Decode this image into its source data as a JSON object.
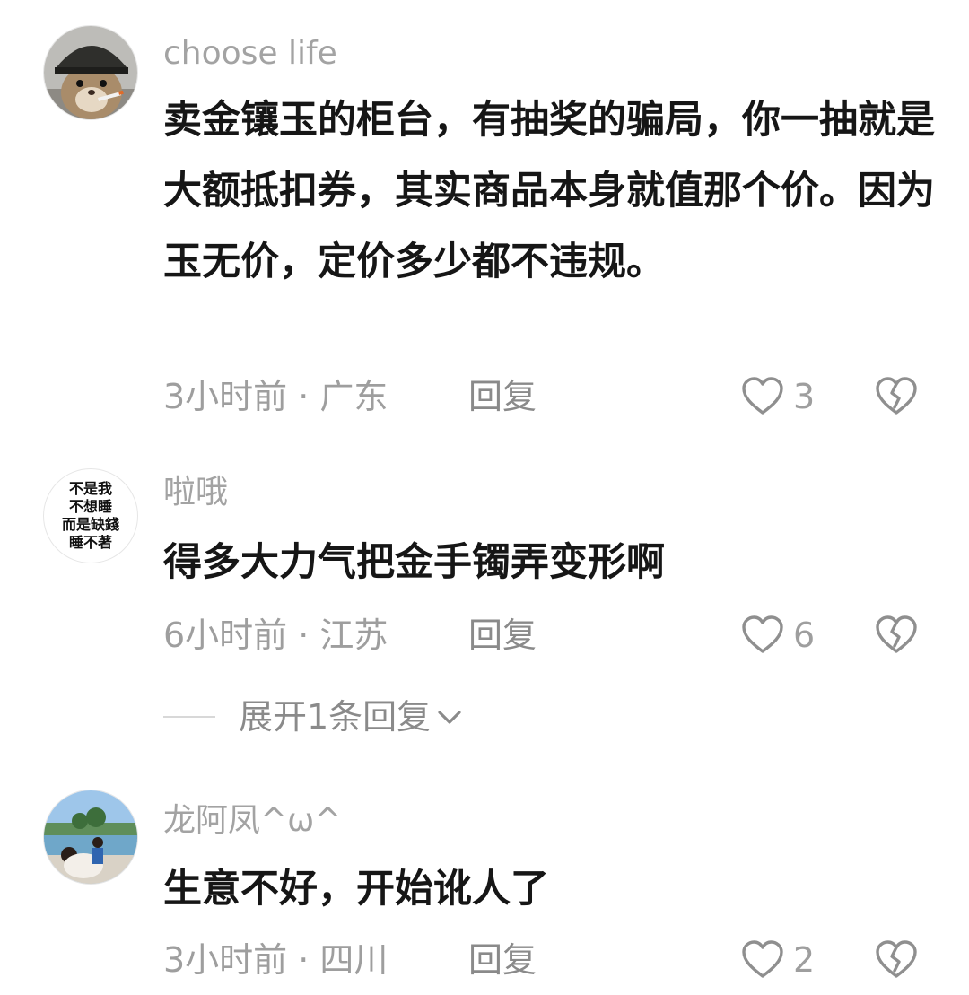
{
  "comments": [
    {
      "author": "choose life",
      "avatar": "helmet-hamster-avatar",
      "content": "卖金镶玉的柜台，有抽奖的骗局，你一抽就是大额抵扣券，其实商品本身就值那个价。因为玉无价，定价多少都不违规。",
      "meta": "3小时前 · 广东",
      "reply_label": "回复",
      "likes": "3"
    },
    {
      "author": "啦哦",
      "avatar": "calligraphy-text-avatar",
      "avatar_text": [
        "不是我",
        "不想睡",
        "而是缺錢",
        "睡不著"
      ],
      "content": "得多大力气把金手镯弄变形啊",
      "meta": "6小时前 · 江苏",
      "reply_label": "回复",
      "likes": "6",
      "expand_label": "展开1条回复"
    },
    {
      "author": "龙阿凤^ω^",
      "avatar": "beach-photo-avatar",
      "content": "生意不好，开始讹人了",
      "meta": "3小时前 · 四川",
      "reply_label": "回复",
      "likes": "2"
    }
  ],
  "icons": {
    "like": "heart-outline-icon",
    "dislike": "broken-heart-icon",
    "expand": "chevron-down-icon"
  },
  "colors": {
    "text_primary": "#161616",
    "text_secondary": "#9e9e9e",
    "author": "#a3a3a3"
  }
}
